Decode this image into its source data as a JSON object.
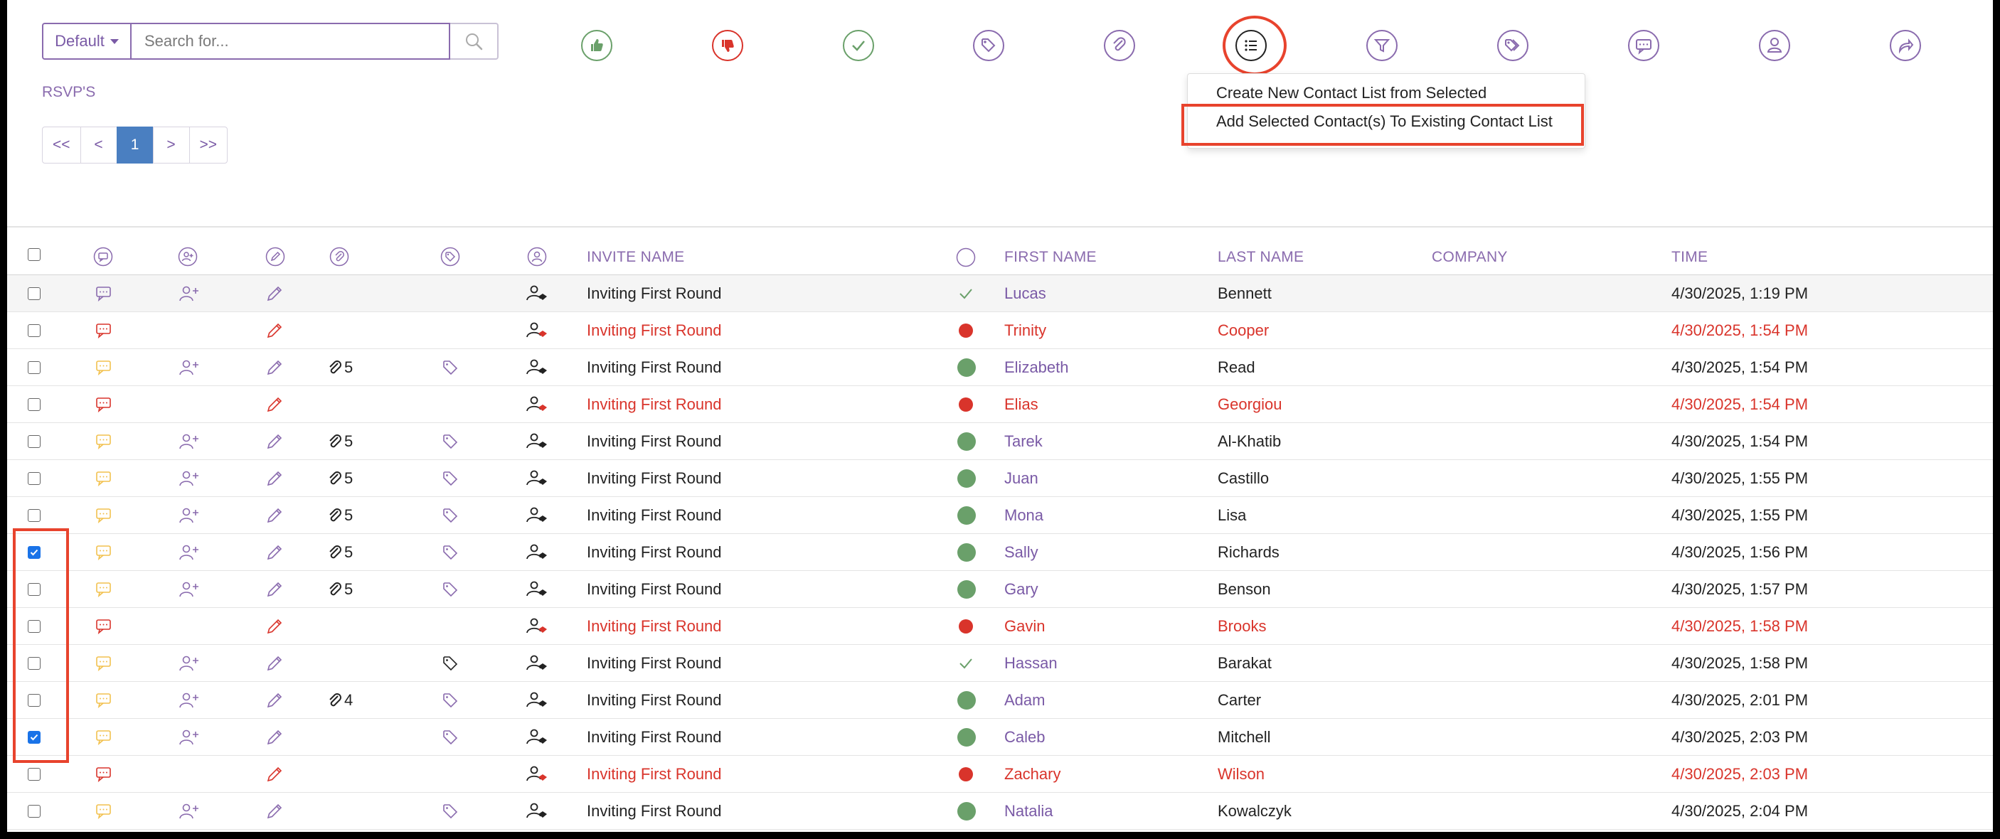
{
  "search": {
    "default_label": "Default",
    "placeholder": "Search for..."
  },
  "rsvp_label": "RSVP'S",
  "pagination": [
    "<<",
    "<",
    "1",
    ">",
    ">>"
  ],
  "pagination_active": "1",
  "toolbar_icons": [
    "thumbs-up-icon",
    "thumbs-down-icon",
    "check-icon",
    "tag-icon",
    "paperclip-icon",
    "list-icon",
    "filter-icon",
    "tags-icon",
    "comment-icon",
    "user-icon",
    "share-icon"
  ],
  "list_menu": {
    "create": "Create New Contact List from Selected",
    "add": "Add Selected Contact(s) To Existing Contact List"
  },
  "table": {
    "headers": {
      "invite_name": "INVITE NAME",
      "first_name": "FIRST NAME",
      "last_name": "LAST NAME",
      "company": "COMPANY",
      "time": "TIME"
    },
    "rows": [
      {
        "checked": false,
        "status": "green-check",
        "comment": "gray",
        "adduser": true,
        "attach": "",
        "tag": "",
        "invite": "Inviting First Round",
        "first": "Lucas",
        "last": "Bennett",
        "company": "",
        "time": "4/30/2025, 1:19 PM",
        "highlight": true
      },
      {
        "checked": false,
        "status": "red",
        "comment": "red",
        "adduser": false,
        "attach": "",
        "tag": "",
        "invite": "Inviting First Round",
        "first": "Trinity",
        "last": "Cooper",
        "company": "",
        "time": "4/30/2025, 1:54 PM"
      },
      {
        "checked": false,
        "status": "green",
        "comment": "yellow",
        "adduser": true,
        "attach": "5",
        "tag": "purple",
        "invite": "Inviting First Round",
        "first": "Elizabeth",
        "last": "Read",
        "company": "",
        "time": "4/30/2025, 1:54 PM"
      },
      {
        "checked": false,
        "status": "red",
        "comment": "red",
        "adduser": false,
        "attach": "",
        "tag": "",
        "invite": "Inviting First Round",
        "first": "Elias",
        "last": "Georgiou",
        "company": "",
        "time": "4/30/2025, 1:54 PM"
      },
      {
        "checked": false,
        "status": "green",
        "comment": "yellow",
        "adduser": true,
        "attach": "5",
        "tag": "purple",
        "invite": "Inviting First Round",
        "first": "Tarek",
        "last": "Al-Khatib",
        "company": "",
        "time": "4/30/2025, 1:54 PM"
      },
      {
        "checked": false,
        "status": "green",
        "comment": "yellow",
        "adduser": true,
        "attach": "5",
        "tag": "purple",
        "invite": "Inviting First Round",
        "first": "Juan",
        "last": "Castillo",
        "company": "",
        "time": "4/30/2025, 1:55 PM"
      },
      {
        "checked": false,
        "status": "green",
        "comment": "yellow",
        "adduser": true,
        "attach": "5",
        "tag": "purple",
        "invite": "Inviting First Round",
        "first": "Mona",
        "last": "Lisa",
        "company": "",
        "time": "4/30/2025, 1:55 PM"
      },
      {
        "checked": true,
        "status": "green",
        "comment": "yellow",
        "adduser": true,
        "attach": "5",
        "tag": "purple",
        "invite": "Inviting First Round",
        "first": "Sally",
        "last": "Richards",
        "company": "",
        "time": "4/30/2025, 1:56 PM"
      },
      {
        "checked": false,
        "status": "green",
        "comment": "yellow",
        "adduser": true,
        "attach": "5",
        "tag": "purple",
        "invite": "Inviting First Round",
        "first": "Gary",
        "last": "Benson",
        "company": "",
        "time": "4/30/2025, 1:57 PM"
      },
      {
        "checked": false,
        "status": "red",
        "comment": "red",
        "adduser": false,
        "attach": "",
        "tag": "",
        "invite": "Inviting First Round",
        "first": "Gavin",
        "last": "Brooks",
        "company": "",
        "time": "4/30/2025, 1:58 PM"
      },
      {
        "checked": false,
        "status": "green-check",
        "comment": "yellow",
        "adduser": true,
        "attach": "",
        "tag": "dark",
        "invite": "Inviting First Round",
        "first": "Hassan",
        "last": "Barakat",
        "company": "",
        "time": "4/30/2025, 1:58 PM"
      },
      {
        "checked": false,
        "status": "green",
        "comment": "yellow",
        "adduser": true,
        "attach": "4",
        "tag": "purple",
        "invite": "Inviting First Round",
        "first": "Adam",
        "last": "Carter",
        "company": "",
        "time": "4/30/2025, 2:01 PM"
      },
      {
        "checked": true,
        "status": "green",
        "comment": "yellow",
        "adduser": true,
        "attach": "",
        "tag": "purple",
        "invite": "Inviting First Round",
        "first": "Caleb",
        "last": "Mitchell",
        "company": "",
        "time": "4/30/2025, 2:03 PM"
      },
      {
        "checked": false,
        "status": "red",
        "comment": "red",
        "adduser": false,
        "attach": "",
        "tag": "",
        "invite": "Inviting First Round",
        "first": "Zachary",
        "last": "Wilson",
        "company": "",
        "time": "4/30/2025, 2:03 PM"
      },
      {
        "checked": false,
        "status": "green",
        "comment": "yellow",
        "adduser": true,
        "attach": "",
        "tag": "purple",
        "invite": "Inviting First Round",
        "first": "Natalia",
        "last": "Kowalczyk",
        "company": "",
        "time": "4/30/2025, 2:04 PM"
      }
    ]
  },
  "colors": {
    "purple": "#8a6bae",
    "link_purple": "#7a5aa6",
    "red": "#d9342b",
    "green": "#6aa06a",
    "yellow": "#f2c14e",
    "highlight_red": "#e8432d",
    "active_blue": "#4a7fc1"
  }
}
